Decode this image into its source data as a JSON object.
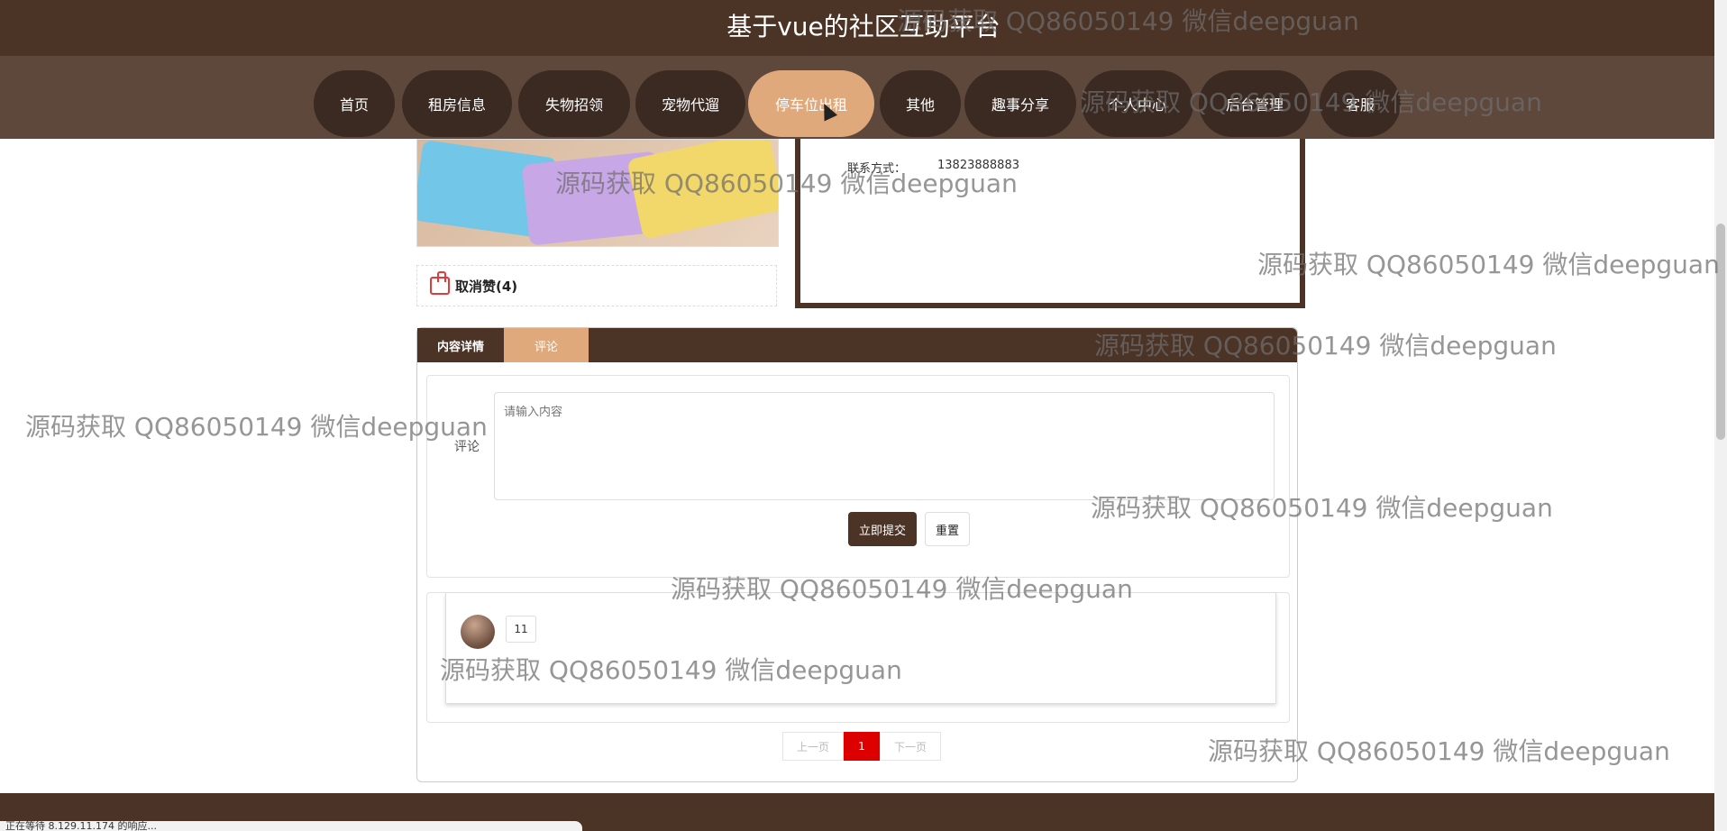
{
  "header": {
    "title": "基于vue的社区互助平台"
  },
  "nav": {
    "items": [
      "首页",
      "租房信息",
      "失物招领",
      "宠物代遛",
      "停车位出租",
      "其他",
      "趣事分享",
      "个人中心",
      "后台管理",
      "客服"
    ],
    "active": "停车位出租"
  },
  "detail": {
    "contact_label": "联系方式：",
    "contact_value": "13823888883",
    "like_label": "取消赞(4)"
  },
  "tabs": {
    "content": "内容详情",
    "comment": "评论"
  },
  "comment_form": {
    "label": "评论",
    "placeholder": "请输入内容",
    "submit": "立即提交",
    "reset": "重置"
  },
  "comments": [
    {
      "text": "11"
    }
  ],
  "pagination": {
    "prev": "上一页",
    "current": "1",
    "next": "下一页"
  },
  "status_bar": "正在等待 8.129.11.174 的响应...",
  "watermark": "源码获取 QQ86050149 微信deepguan",
  "colors": {
    "brand_dark": "#4b3326",
    "nav_bg": "#5e473b",
    "accent": "#e0a97c",
    "page_active": "#dd0000"
  }
}
